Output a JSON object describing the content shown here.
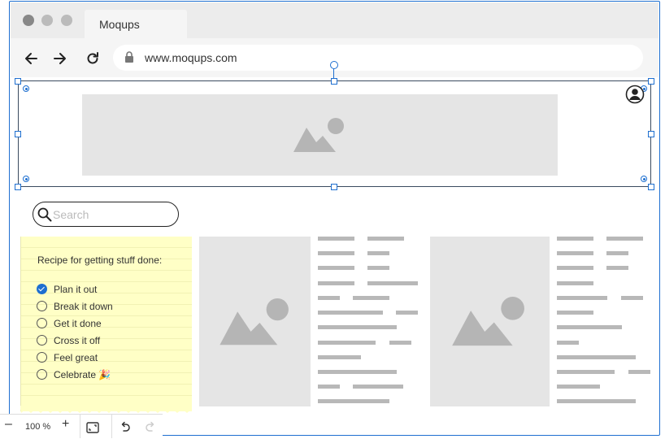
{
  "browser": {
    "tab_title": "Moqups",
    "url": "www.moqups.com",
    "icons": [
      "back-arrow-icon",
      "forward-arrow-icon",
      "reload-icon",
      "lock-icon"
    ]
  },
  "header": {
    "icons": [
      "image-placeholder-icon",
      "user-avatar-icon"
    ]
  },
  "search": {
    "placeholder": "Search",
    "value": ""
  },
  "note": {
    "title": "Recipe for getting stuff done:",
    "items": [
      {
        "label": "Plan it out",
        "checked": true
      },
      {
        "label": "Break it down",
        "checked": false
      },
      {
        "label": "Get it done",
        "checked": false
      },
      {
        "label": "Cross it off",
        "checked": false
      },
      {
        "label": "Feel great",
        "checked": false
      },
      {
        "label": "Celebrate 🎉",
        "checked": false
      }
    ]
  },
  "toolbar": {
    "zoom": "100 %",
    "zoom_out_label": "–",
    "zoom_in_label": "+",
    "icons": [
      "fit-screen-icon",
      "undo-icon",
      "redo-icon"
    ]
  },
  "colors": {
    "accent": "#1e6fd0",
    "note_bg": "#ffffc6",
    "placeholder_gray": "#e5e5e5",
    "text_line_gray": "#b8b8b8"
  }
}
